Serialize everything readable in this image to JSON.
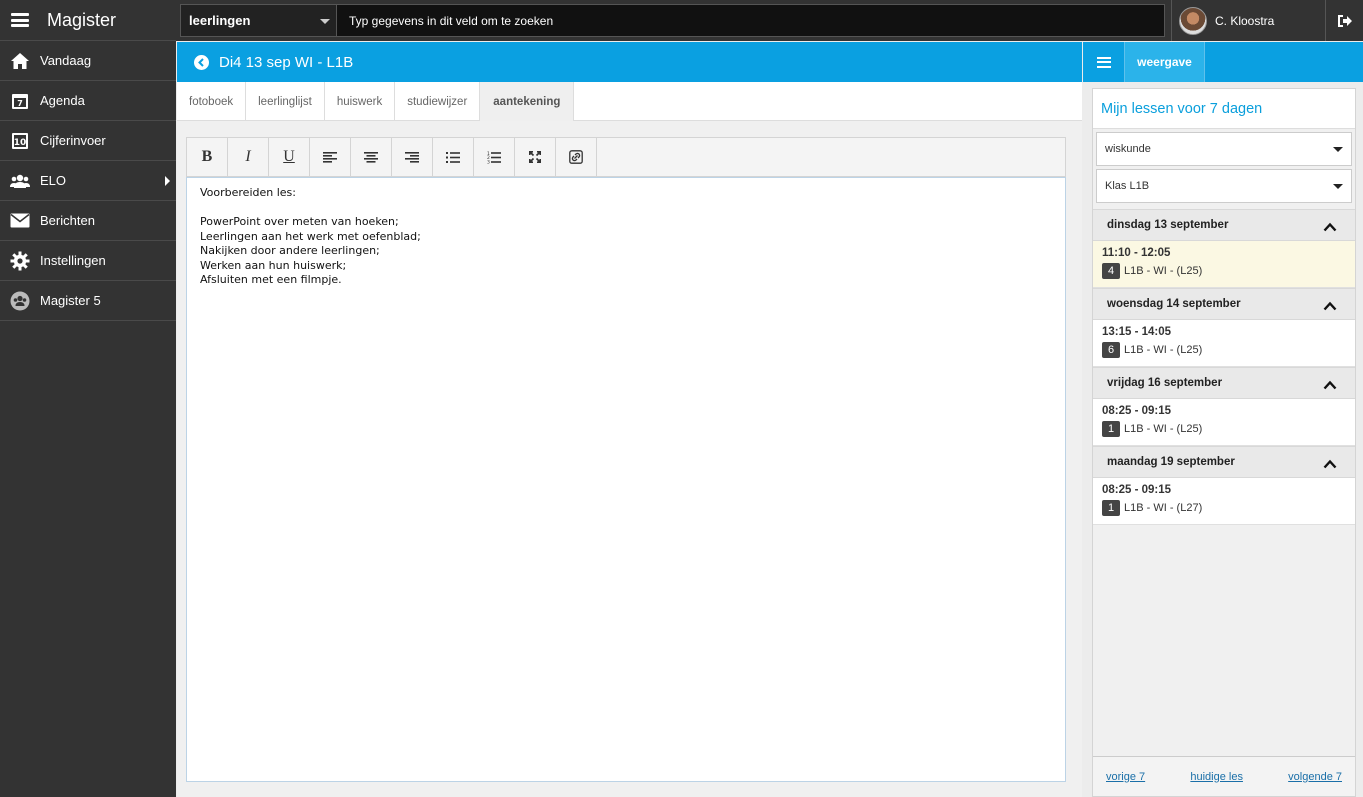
{
  "app": {
    "title": "Magister"
  },
  "nav": [
    {
      "label": "Vandaag",
      "icon": "home-icon"
    },
    {
      "label": "Agenda",
      "icon": "calendar-icon"
    },
    {
      "label": "Cijferinvoer",
      "icon": "grades-icon"
    },
    {
      "label": "ELO",
      "icon": "users-icon",
      "has_submenu": true
    },
    {
      "label": "Berichten",
      "icon": "envelope-icon"
    },
    {
      "label": "Instellingen",
      "icon": "gear-icon"
    },
    {
      "label": "Magister 5",
      "icon": "group-icon"
    }
  ],
  "search": {
    "scope": "leerlingen",
    "placeholder": "Typ gegevens in dit veld om te zoeken"
  },
  "user": {
    "name": "C. Kloostra"
  },
  "lesson": {
    "title": "Di4 13 sep WI - L1B"
  },
  "tabs": [
    {
      "label": "fotoboek",
      "active": false
    },
    {
      "label": "leerlinglijst",
      "active": false
    },
    {
      "label": "huiswerk",
      "active": false
    },
    {
      "label": "studiewijzer",
      "active": false
    },
    {
      "label": "aantekening",
      "active": true
    }
  ],
  "toolbar": {
    "bold": "B",
    "italic": "I",
    "underline": "U"
  },
  "editor": {
    "lines": [
      "Voorbereiden les:",
      "",
      "PowerPoint over meten van hoeken;",
      "Leerlingen aan het werk met oefenblad;",
      "Nakijken door andere leerlingen;",
      "Werken aan hun huiswerk;",
      "Afsluiten met een filmpje."
    ]
  },
  "right_panel": {
    "tab_label": "weergave",
    "title": "Mijn lessen voor 7 dagen",
    "subject_select": "wiskunde",
    "class_select": "Klas L1B",
    "days": [
      {
        "label": "dinsdag 13 september",
        "time": "11:10 - 12:05",
        "period": "4",
        "desc": "L1B - WI - (L25)",
        "current": true
      },
      {
        "label": "woensdag 14 september",
        "time": "13:15 - 14:05",
        "period": "6",
        "desc": "L1B - WI - (L25)",
        "current": false
      },
      {
        "label": "vrijdag 16 september",
        "time": "08:25 - 09:15",
        "period": "1",
        "desc": "L1B - WI - (L25)",
        "current": false
      },
      {
        "label": "maandag 19 september",
        "time": "08:25 - 09:15",
        "period": "1",
        "desc": "L1B - WI - (L27)",
        "current": false
      }
    ],
    "footer": {
      "prev": "vorige 7",
      "current": "huidige les",
      "next": "volgende 7"
    }
  },
  "colors": {
    "accent": "#0aa0e1",
    "sidebar": "#333333",
    "highlight": "#fbf8e3"
  }
}
